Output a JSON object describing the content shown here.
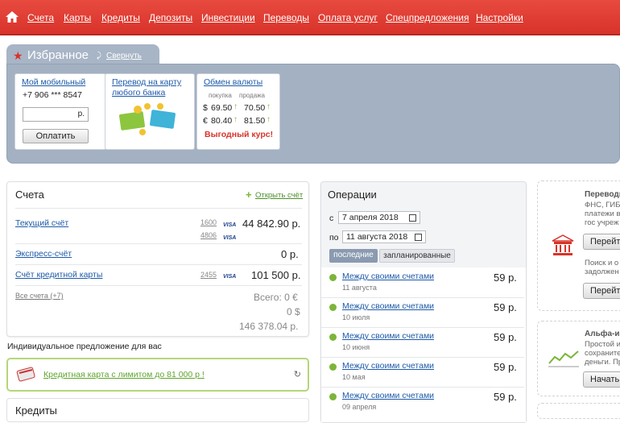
{
  "nav": {
    "items": [
      "Счета",
      "Карты",
      "Кредиты",
      "Депозиты",
      "Инвестиции",
      "Переводы",
      "Оплата услуг",
      "Спецпредложения",
      "Настройки"
    ]
  },
  "favorites": {
    "title": "Избранное",
    "collapse": "Свернуть",
    "mobile": {
      "title": "Мой мобильный",
      "phone": "+7 906 *** 8547",
      "currency": "р.",
      "pay": "Оплатить"
    },
    "transfer": {
      "title": "Перевод на карту любого банка"
    },
    "exchange": {
      "title": "Обмен валюты",
      "buy": "покупка",
      "sell": "продажа",
      "rows": [
        {
          "cur": "$",
          "buy": "69.50",
          "sell": "70.50"
        },
        {
          "cur": "€",
          "buy": "80.40",
          "sell": "81.50"
        }
      ],
      "promo": "Выгодный курс!"
    }
  },
  "accounts": {
    "title": "Счета",
    "open": "Открыть счёт",
    "items": [
      {
        "name": "Текущий счёт",
        "card1": "1600",
        "card2": "4806",
        "amount": "44 842.90 р."
      },
      {
        "name": "Экспресс-счёт",
        "amount": "0 р."
      },
      {
        "name": "Счёт кредитной карты",
        "card1": "2455",
        "amount": "101 500 р."
      }
    ],
    "all": "Все счета (+7)",
    "total_label": "Всего: 0 €",
    "total2": "0 $",
    "total3": "146 378.04 р.",
    "offer_title": "Индивидуальное предложение для вас",
    "offer": "Кредитная карта с лимитом до 81 000 р !",
    "credits": "Кредиты"
  },
  "operations": {
    "title": "Операции",
    "from_label": "с",
    "from": "7 апреля 2018",
    "to_label": "по",
    "to": "11 августа 2018",
    "tab_recent": "последние",
    "tab_planned": "запланированные",
    "items": [
      {
        "name": "Между своими счетами",
        "date": "11 августа",
        "amount": "59 р."
      },
      {
        "name": "Между своими счетами",
        "date": "10 июля",
        "amount": "59 р."
      },
      {
        "name": "Между своими счетами",
        "date": "10 июня",
        "amount": "59 р."
      },
      {
        "name": "Между своими счетами",
        "date": "10 мая",
        "amount": "59 р."
      },
      {
        "name": "Между своими счетами",
        "date": "09 апреля",
        "amount": "59 р."
      }
    ]
  },
  "right": {
    "p1_title": "Переводы",
    "p1_l1": "ФНС, ГИБ",
    "p1_l2": "платежи в",
    "p1_l3": "гос учреж",
    "p1_btn": "Перейти",
    "p1_l4": "Поиск и о",
    "p1_l5": "задолжен",
    "p1_btn2": "Перейти",
    "p2_title": "Альфа-и",
    "p2_l1": "Простой и",
    "p2_l2": "сохраните",
    "p2_l3": "деньги. Пр",
    "p2_btn": "Начать"
  },
  "colors": {
    "brand": "#e0392f",
    "link": "#1d5aa8",
    "panel": "#a3b1c2",
    "green": "#7bb53a"
  }
}
